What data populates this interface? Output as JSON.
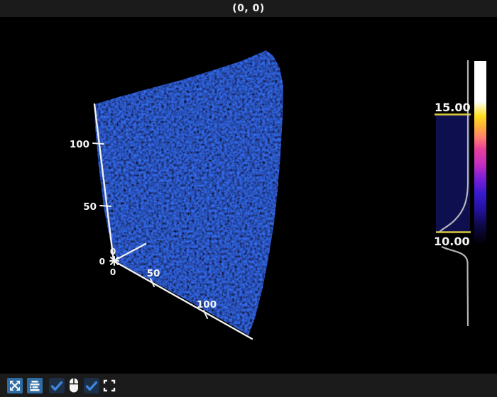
{
  "window": {
    "title": "(0, 0)"
  },
  "viewport": {
    "background": "#000000",
    "volume": {
      "kind": "noisy blue volume rendering",
      "base_color": "#0505a5"
    },
    "axes": {
      "vertical_tick_labels": [
        "100",
        "50",
        "0"
      ],
      "bottom_tick_labels": [
        "0",
        "50",
        "100"
      ],
      "depth_tick_labels": [
        "0"
      ]
    }
  },
  "transfer_function": {
    "upper_bound_label": "15.00",
    "lower_bound_label": "10.00",
    "bound_line_color": "#d9c93a",
    "histogram_fill": "#0e0f4e",
    "curve_color": "#c8c8c8",
    "colormap_bottom_to_top": [
      "#000000",
      "#0d0845",
      "#2413a6",
      "#3a1ad0",
      "#7a1fd8",
      "#c72fc0",
      "#e8409a",
      "#ff7d72",
      "#ffae3c",
      "#ffe01e",
      "#ffffff"
    ]
  },
  "toolbar": {
    "button_bg": "#2e6da4",
    "checkbox_bg": "#1c2f47",
    "check_color": "#3d85d8",
    "icon_color": "#f5f5f5",
    "buttons": [
      {
        "name": "reset-camera",
        "icon": "expand-arrows"
      },
      {
        "name": "layer-stack",
        "icon": "stacked-bars"
      },
      {
        "name": "checkbox-1",
        "type": "checkbox",
        "checked": true
      },
      {
        "name": "mouse-mode",
        "icon": "mouse"
      },
      {
        "name": "checkbox-2",
        "type": "checkbox",
        "checked": true
      },
      {
        "name": "fullscreen",
        "icon": "fullscreen-corners"
      }
    ]
  }
}
